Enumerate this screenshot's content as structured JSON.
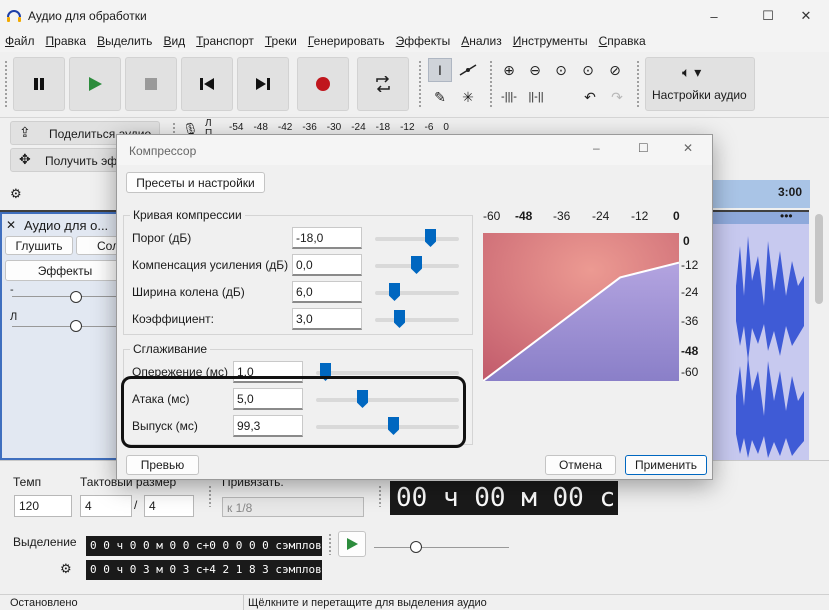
{
  "window": {
    "title": "Аудио для обработки",
    "minimize": "–",
    "maximize": "☐",
    "close": "✕"
  },
  "menu": [
    "Файл",
    "Правка",
    "Выделить",
    "Вид",
    "Транспорт",
    "Треки",
    "Генерировать",
    "Эффекты",
    "Анализ",
    "Инструменты",
    "Справка"
  ],
  "toolbar": {
    "audio_settings": "Настройки аудио",
    "share": "Поделиться аудио",
    "get_effects": "Получить эффекты"
  },
  "meter_scale": [
    "-54",
    "-48",
    "-42",
    "-36",
    "-30",
    "-24",
    "-18",
    "-12",
    "-6",
    "0"
  ],
  "meter_letters": [
    "Л",
    "П"
  ],
  "timeline": {
    "mark": "3:00"
  },
  "track": {
    "name": "Аудио для о...",
    "mute": "Глушить",
    "solo": "Соло",
    "effects": "Эффекты",
    "pan_left": "-",
    "pan_label": "Л"
  },
  "bottom": {
    "tempo_label": "Темп",
    "tempo_value": "120",
    "time_sig_label": "Тактовый размер",
    "time_sig_num": "4",
    "time_sig_sep": "/",
    "time_sig_den": "4",
    "snap_label": "Привязать.",
    "snap_value": "к 1/8",
    "big_time": "00 ч 00 м 00 с",
    "selection_label": "Выделение",
    "sel_start": "0 0 ч 0 0 м 0 0 с+0 0 0 0 0 сэмплов",
    "sel_end": "0 0 ч 0 3 м 0 3 с+4 2 1 8 3 сэмплов"
  },
  "status": {
    "left": "Остановлено",
    "right": "Щёлкните и перетащите для выделения аудио"
  },
  "dialog": {
    "title": "Компрессор",
    "presets": "Пресеты и настройки",
    "curve_group": "Кривая компрессии",
    "params": [
      {
        "label": "Порог (дБ)",
        "value": "-18,0",
        "slider": 0.67
      },
      {
        "label": "Компенсация усиления (дБ)",
        "value": "0,0",
        "slider": 0.5
      },
      {
        "label": "Ширина колена (дБ)",
        "value": "6,0",
        "slider": 0.23
      },
      {
        "label": "Коэффициент:",
        "value": "3,0",
        "slider": 0.28
      }
    ],
    "smooth_group": "Сглаживание",
    "lookahead": {
      "label": "Опережение (мс)",
      "value": "1,0",
      "slider": 0.05
    },
    "attack": {
      "label": "Атака (мс)",
      "value": "5,0",
      "slider": 0.32
    },
    "release": {
      "label": "Выпуск (мс)",
      "value": "99,3",
      "slider": 0.54
    },
    "preview": "Превью",
    "cancel": "Отмена",
    "apply": "Применить",
    "graph_top_ticks": [
      "-60",
      "-48",
      "-36",
      "-24",
      "-12",
      "0"
    ],
    "graph_right_ticks": [
      "0",
      "-12",
      "-24",
      "-36",
      "-48",
      "-60"
    ],
    "curve": {
      "threshold_db": -18,
      "ratio": 3,
      "range_db": [
        -60,
        0
      ]
    }
  }
}
